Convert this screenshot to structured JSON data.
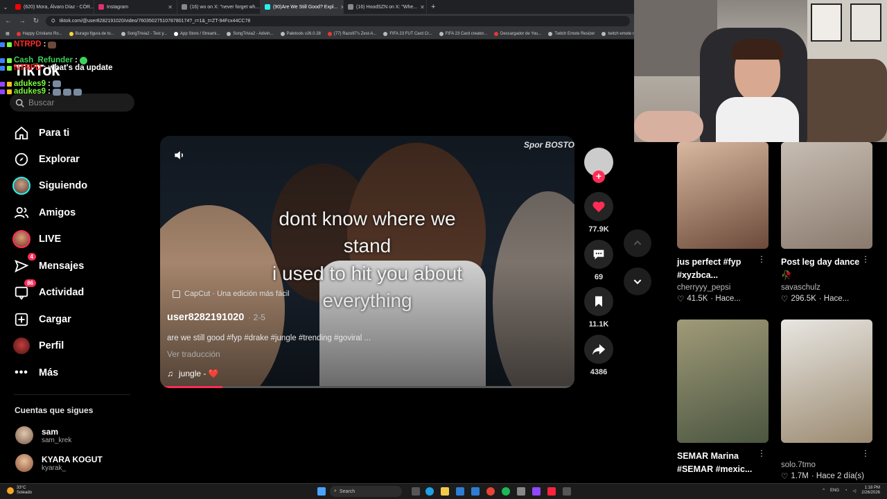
{
  "browser": {
    "tabs": [
      {
        "label": "(620) Mora, Álvaro Díaz - CÓR...",
        "color": "#ff0000"
      },
      {
        "label": "Instagram",
        "color": "#e1306c"
      },
      {
        "label": "(16) wo on X: \"never forget wh...",
        "color": "#888888"
      },
      {
        "label": "(90)Are We Still Good? Expl...",
        "color": "#25f4ee",
        "active": true
      },
      {
        "label": "(16) HoodSZN on X: \"Whe...",
        "color": "#888888"
      }
    ],
    "url": "tiktok.com/@user8282191020/video/7603502751078780174?_r=1&_t=ZT-94Fcx44CC78",
    "bookmarks": [
      {
        "label": "Happy Cristiano Ro...",
        "color": "#e53935"
      },
      {
        "label": "Burago figura de to...",
        "color": "#fdd835"
      },
      {
        "label": "SongTrivia2 - Test y...",
        "color": "#bbbbbb"
      },
      {
        "label": "App Store / Streami...",
        "color": "#ffffff"
      },
      {
        "label": "SongTrivia2 - Adivin...",
        "color": "#bbbbbb"
      },
      {
        "label": "Paletools v26.0.28",
        "color": "#bbbbbb"
      },
      {
        "label": "(77) Razo97's Zest-A...",
        "color": "#e53935"
      },
      {
        "label": "FIFA 23 FUT Card Cr...",
        "color": "#bbbbbb"
      },
      {
        "label": "FIFA 23 Card creator...",
        "color": "#bbbbbb"
      },
      {
        "label": "Descargador de You...",
        "color": "#e53935"
      },
      {
        "label": "Twitch Emote Resizer",
        "color": "#bbbbbb"
      },
      {
        "label": "twitch emote re...",
        "color": "#bbbbbb"
      }
    ]
  },
  "chat": [
    {
      "user": "NTRPD",
      "color": "#ff2a2a",
      "msg": ":"
    },
    {
      "user": "Cash_Refunder",
      "color": "#3cd25a",
      "msg": ":"
    },
    {
      "user": "NTRPD",
      "color": "#ff2a2a",
      "msg": ": what's da update"
    },
    {
      "user": "adukes9",
      "color": "#7dff3c",
      "msg": ":"
    },
    {
      "user": "adukes9",
      "color": "#7dff3c",
      "msg": ":"
    }
  ],
  "sidebar": {
    "logo": "TikTok",
    "search_placeholder": "Buscar",
    "nav": [
      {
        "label": "Para ti",
        "icon": "home-icon"
      },
      {
        "label": "Explorar",
        "icon": "compass-icon"
      },
      {
        "label": "Siguiendo",
        "icon": "following-avatar-icon"
      },
      {
        "label": "Amigos",
        "icon": "friends-icon"
      },
      {
        "label": "LIVE",
        "icon": "live-avatar-icon"
      },
      {
        "label": "Mensajes",
        "icon": "message-icon",
        "badge": "4"
      },
      {
        "label": "Actividad",
        "icon": "activity-icon",
        "badge": "86"
      },
      {
        "label": "Cargar",
        "icon": "upload-icon"
      },
      {
        "label": "Perfil",
        "icon": "profile-avatar-icon"
      },
      {
        "label": "Más",
        "icon": "more-icon"
      }
    ],
    "following_title": "Cuentas que sigues",
    "accounts": [
      {
        "name": "sam",
        "handle": "sam_krek"
      },
      {
        "name": "KYARA KOGUT",
        "handle": "kyarak_"
      }
    ]
  },
  "video": {
    "watermark": "Spor BOSTO",
    "caption_lines": [
      "dont know where we",
      "stand",
      "i used to hit you about",
      "everything"
    ],
    "capcut": "CapCut · Una edición más fácil",
    "user": "user8282191020",
    "date": "· 2-5",
    "description": "are we still good #fyp #drake #jungle #trending #goviral ...",
    "translate": "Ver traducción",
    "sound": "jungle - ❤️",
    "progress": 0.15
  },
  "actions": {
    "likes": "77.9K",
    "comments": "69",
    "saves": "11.1K",
    "shares": "4386"
  },
  "grid": [
    {
      "title": "jus perfect #fyp #xyzbca...",
      "author": "cherryyy_pepsi",
      "stat": "41.5K",
      "time": "· Hace...",
      "c1": "#6b4a3a",
      "c2": "#d9b8a0"
    },
    {
      "title": "Post leg day dance 🥀",
      "author": "savaschulz",
      "stat": "296.5K",
      "time": "· Hace...",
      "c1": "#8a7a6e",
      "c2": "#c7bdb2"
    },
    {
      "title": "SEMAR Marina #SEMAR #mexic...",
      "author": "",
      "stat": "",
      "time": "",
      "c1": "#4a5540",
      "c2": "#a09a78"
    },
    {
      "title": "",
      "author": "solo.7tmo",
      "stat": "1.7M",
      "time": "· Hace 2 día(s)",
      "c1": "#e8e6e2",
      "c2": "#9b8a70"
    }
  ],
  "taskbar": {
    "temp": "33°C",
    "weather": "Soleado",
    "search": "Search",
    "lang": "ENG",
    "time": "1:18 PM",
    "date": "2/26/2026"
  }
}
